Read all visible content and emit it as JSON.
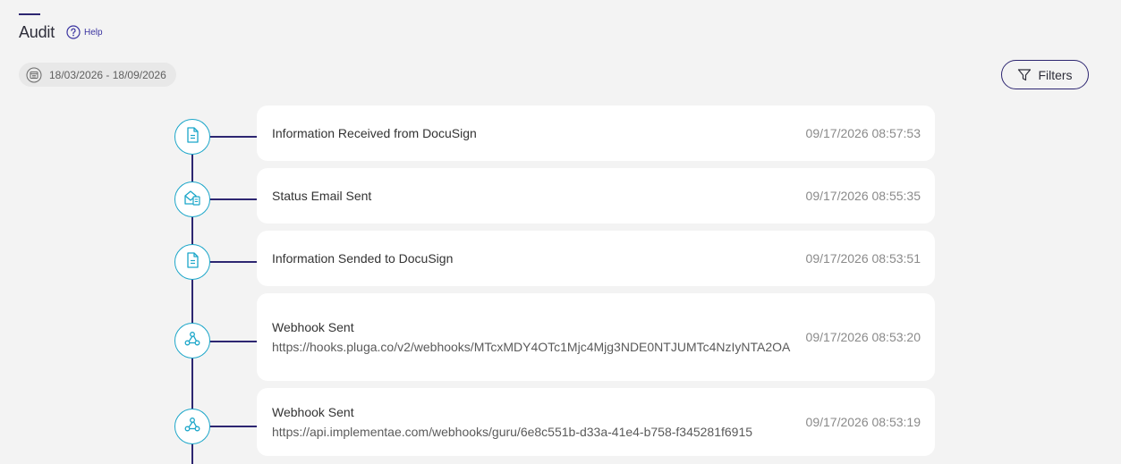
{
  "header": {
    "title": "Audit",
    "help_label": "Help"
  },
  "toolbar": {
    "date_range": "18/03/2026 - 18/09/2026",
    "filters_label": "Filters"
  },
  "colors": {
    "accent": "#2d2671",
    "node_border": "#1ba6c9",
    "background": "#f3f3f3"
  },
  "events": [
    {
      "icon": "document-icon",
      "title": "Information Received from DocuSign",
      "detail": "",
      "timestamp": "09/17/2026 08:57:53"
    },
    {
      "icon": "email-document-icon",
      "title": "Status Email Sent",
      "detail": "",
      "timestamp": "09/17/2026 08:55:35"
    },
    {
      "icon": "document-icon",
      "title": "Information Sended to DocuSign",
      "detail": "",
      "timestamp": "09/17/2026 08:53:51"
    },
    {
      "icon": "webhook-icon",
      "title": "Webhook Sent",
      "detail": "https://hooks.pluga.co/v2/webhooks/MTcxMDY4OTc1Mjc4Mjg3NDE0NTJUMTc4NzIyNTA2OA",
      "timestamp": "09/17/2026 08:53:20"
    },
    {
      "icon": "webhook-icon",
      "title": "Webhook Sent",
      "detail": "https://api.implementae.com/webhooks/guru/6e8c551b-d33a-41e4-b758-f345281f6915",
      "timestamp": "09/17/2026 08:53:19"
    }
  ]
}
